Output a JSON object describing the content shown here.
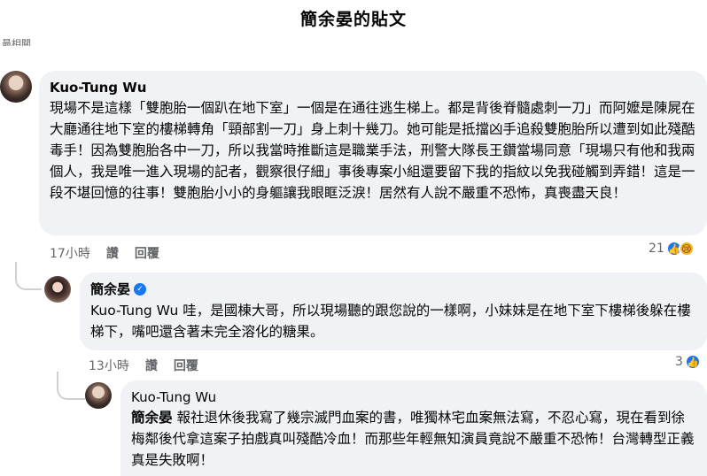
{
  "header": {
    "title": "簡余晏的貼文"
  },
  "cutoff_text": "最相關",
  "comments": [
    {
      "author": "Kuo-Tung Wu",
      "mention": "",
      "text": "現場不是這樣「雙胞胎一個趴在地下室」一個是在通往逃生梯上。都是背後脊髓處刺一刀」而阿嬤是陳屍在大廳通往地下室的樓梯轉角「頸部割一刀」身上刺十幾刀。她可能是抵擋凶手追殺雙胞胎所以遭到如此殘酷毒手！因為雙胞胎各中一刀，所以我當時推斷這是職業手法，刑警大隊長王鑽當場同意「現場只有他和我兩個人，我是唯一進入現場的記者，觀察很仔細」事後專案小組還要留下我的指紋以免我碰觸到弄錯！這是一段不堪回憶的往事！雙胞胎小小的身軀讓我眼眶泛淚！居然有人說不嚴重不恐怖，真喪盡天良！",
      "time": "17小時",
      "like_label": "讚",
      "reply_label": "回覆",
      "reaction_count": "21"
    },
    {
      "author": "簡余晏",
      "mention": "Kuo-Tung Wu",
      "text": " 哇，是國棟大哥，所以現場聽的跟您說的一樣啊，小妹妹是在地下室下樓梯後躲在樓梯下，嘴吧還含著未完全溶化的糖果。",
      "time": "13小時",
      "like_label": "讚",
      "reply_label": "回覆",
      "reaction_count": "3"
    },
    {
      "author": "Kuo-Tung Wu",
      "mention": "簡余晏",
      "text": " 報社退休後我寫了幾宗滅門血案的書，唯獨林宅血案無法寫，不忍心寫，現在看到徐梅鄰後代拿這案子拍戲真叫殘酷冷血！而那些年輕無知演員竟說不嚴重不恐怖！台灣轉型正義真是失敗啊！"
    }
  ],
  "icons": {
    "like": "thumbs-up-icon",
    "sad": "sad-face-icon",
    "verified": "verified-badge-icon"
  },
  "colors": {
    "like": "#1877f2",
    "bubble": "#f0f2f5",
    "meta": "#65676b"
  }
}
